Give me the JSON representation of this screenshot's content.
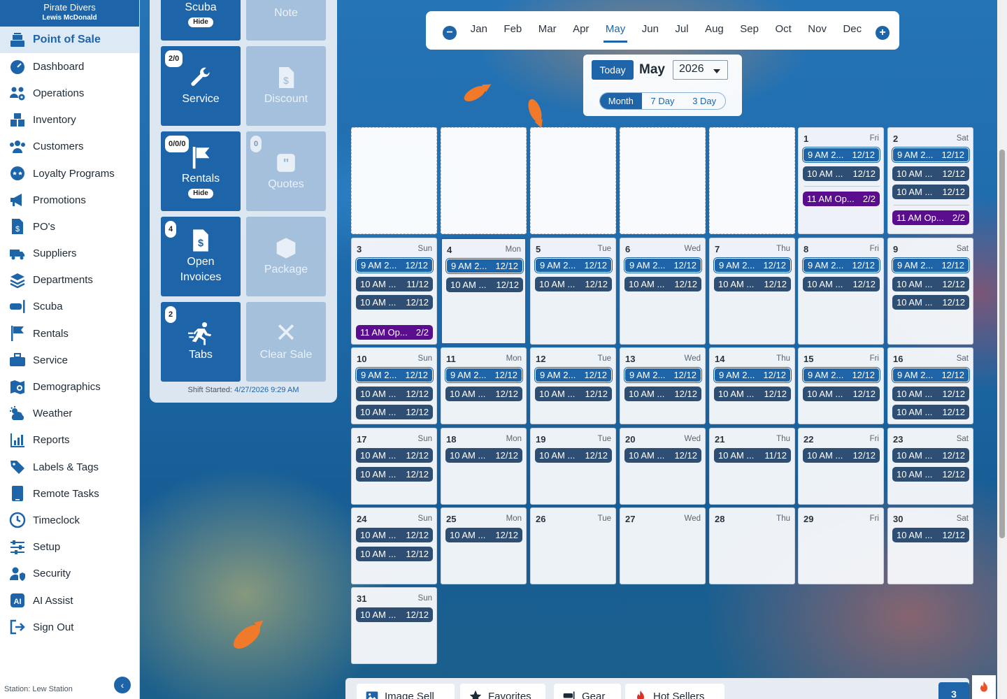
{
  "app": {
    "store_name": "Pirate Divers",
    "user_name": "Lewis McDonald",
    "station": "Station: Lew Station"
  },
  "sidebar": {
    "items": [
      {
        "key": "pos",
        "label": "Point of Sale",
        "icon": "cash-register-icon",
        "active": true
      },
      {
        "key": "dashboard",
        "label": "Dashboard",
        "icon": "gauge-icon"
      },
      {
        "key": "operations",
        "label": "Operations",
        "icon": "people-gear-icon"
      },
      {
        "key": "inventory",
        "label": "Inventory",
        "icon": "boxes-icon"
      },
      {
        "key": "customers",
        "label": "Customers",
        "icon": "users-icon"
      },
      {
        "key": "loyalty",
        "label": "Loyalty Programs",
        "icon": "star-face-icon"
      },
      {
        "key": "promotions",
        "label": "Promotions",
        "icon": "megaphone-icon"
      },
      {
        "key": "pos-orders",
        "label": "PO's",
        "icon": "invoice-icon"
      },
      {
        "key": "suppliers",
        "label": "Suppliers",
        "icon": "truck-icon"
      },
      {
        "key": "departments",
        "label": "Departments",
        "icon": "layers-icon"
      },
      {
        "key": "scuba",
        "label": "Scuba",
        "icon": "mask-icon"
      },
      {
        "key": "rentals",
        "label": "Rentals",
        "icon": "flag-icon"
      },
      {
        "key": "service",
        "label": "Service",
        "icon": "toolbox-icon"
      },
      {
        "key": "demographics",
        "label": "Demographics",
        "icon": "map-pin-icon"
      },
      {
        "key": "weather",
        "label": "Weather",
        "icon": "sun-cloud-icon"
      },
      {
        "key": "reports",
        "label": "Reports",
        "icon": "bar-chart-icon"
      },
      {
        "key": "labels",
        "label": "Labels & Tags",
        "icon": "tag-icon"
      },
      {
        "key": "remote",
        "label": "Remote Tasks",
        "icon": "tablet-icon"
      },
      {
        "key": "timeclock",
        "label": "Timeclock",
        "icon": "clock-icon"
      },
      {
        "key": "setup",
        "label": "Setup",
        "icon": "sliders-icon"
      },
      {
        "key": "security",
        "label": "Security",
        "icon": "user-shield-icon"
      },
      {
        "key": "ai",
        "label": "AI Assist",
        "icon": "ai-icon"
      },
      {
        "key": "signout",
        "label": "Sign Out",
        "icon": "sign-out-icon"
      }
    ]
  },
  "tiles": {
    "scuba": {
      "label": "Scuba",
      "hide": "Hide"
    },
    "note": {
      "label": "Note"
    },
    "service": {
      "label": "Service",
      "badge": "2/0"
    },
    "discount": {
      "label": "Discount"
    },
    "rentals": {
      "label": "Rentals",
      "badge": "0/0/0",
      "hide": "Hide"
    },
    "quotes": {
      "label": "Quotes",
      "badge": "0"
    },
    "open_invoices": {
      "label": "Open Invoices",
      "badge": "4"
    },
    "package": {
      "label": "Package"
    },
    "tabs": {
      "label": "Tabs",
      "badge": "2"
    },
    "clear_sale": {
      "label": "Clear Sale"
    }
  },
  "shift": {
    "label": "Shift Started:",
    "value": "4/27/2026 9:29 AM"
  },
  "calendar": {
    "months": [
      "Jan",
      "Feb",
      "Mar",
      "Apr",
      "May",
      "Jun",
      "Jul",
      "Aug",
      "Sep",
      "Oct",
      "Nov",
      "Dec"
    ],
    "current_month": "May",
    "today_label": "Today",
    "title_month": "May",
    "year": "2026",
    "views": [
      "Month",
      "7 Day",
      "3 Day"
    ],
    "selected_view": "Month",
    "leading_empty": 5,
    "selected_day": 4,
    "days": [
      {
        "d": "1",
        "w": "Fri",
        "ev": [
          [
            "9 AM 2...",
            "12/12",
            "pub"
          ],
          [
            "10 AM ...",
            "12/12",
            "dark"
          ],
          [
            "11 AM Op...",
            "2/2",
            "purple"
          ]
        ]
      },
      {
        "d": "2",
        "w": "Sat",
        "ev": [
          [
            "9 AM 2...",
            "12/12",
            "pub"
          ],
          [
            "10 AM ...",
            "12/12",
            "dark"
          ],
          [
            "10 AM ...",
            "12/12",
            "dark"
          ],
          [
            "11 AM Op...",
            "2/2",
            "purple"
          ]
        ]
      },
      {
        "d": "3",
        "w": "Sun",
        "ev": [
          [
            "9 AM 2...",
            "12/12",
            "pub"
          ],
          [
            "10 AM ...",
            "11/12",
            "dark"
          ],
          [
            "10 AM ...",
            "12/12",
            "dark"
          ],
          [
            "11 AM Op...",
            "2/2",
            "purple"
          ]
        ]
      },
      {
        "d": "4",
        "w": "Mon",
        "ev": [
          [
            "9 AM 2...",
            "12/12",
            "pub"
          ],
          [
            "10 AM ...",
            "12/12",
            "dark"
          ]
        ]
      },
      {
        "d": "5",
        "w": "Tue",
        "ev": [
          [
            "9 AM 2...",
            "12/12",
            "pub"
          ],
          [
            "10 AM ...",
            "12/12",
            "dark"
          ]
        ]
      },
      {
        "d": "6",
        "w": "Wed",
        "ev": [
          [
            "9 AM 2...",
            "12/12",
            "pub"
          ],
          [
            "10 AM ...",
            "12/12",
            "dark"
          ]
        ]
      },
      {
        "d": "7",
        "w": "Thu",
        "ev": [
          [
            "9 AM 2...",
            "12/12",
            "pub"
          ],
          [
            "10 AM ...",
            "12/12",
            "dark"
          ]
        ]
      },
      {
        "d": "8",
        "w": "Fri",
        "ev": [
          [
            "9 AM 2...",
            "12/12",
            "pub"
          ],
          [
            "10 AM ...",
            "12/12",
            "dark"
          ]
        ]
      },
      {
        "d": "9",
        "w": "Sat",
        "ev": [
          [
            "9 AM 2...",
            "12/12",
            "pub"
          ],
          [
            "10 AM ...",
            "12/12",
            "dark"
          ],
          [
            "10 AM ...",
            "12/12",
            "dark"
          ]
        ]
      },
      {
        "d": "10",
        "w": "Sun",
        "ev": [
          [
            "9 AM 2...",
            "12/12",
            "pub"
          ],
          [
            "10 AM ...",
            "12/12",
            "dark"
          ],
          [
            "10 AM ...",
            "12/12",
            "dark"
          ]
        ]
      },
      {
        "d": "11",
        "w": "Mon",
        "ev": [
          [
            "9 AM 2...",
            "12/12",
            "pub"
          ],
          [
            "10 AM ...",
            "12/12",
            "dark"
          ]
        ]
      },
      {
        "d": "12",
        "w": "Tue",
        "ev": [
          [
            "9 AM 2...",
            "12/12",
            "pub"
          ],
          [
            "10 AM ...",
            "12/12",
            "dark"
          ]
        ]
      },
      {
        "d": "13",
        "w": "Wed",
        "ev": [
          [
            "9 AM 2...",
            "12/12",
            "pub"
          ],
          [
            "10 AM ...",
            "12/12",
            "dark"
          ]
        ]
      },
      {
        "d": "14",
        "w": "Thu",
        "ev": [
          [
            "9 AM 2...",
            "12/12",
            "pub"
          ],
          [
            "10 AM ...",
            "12/12",
            "dark"
          ]
        ]
      },
      {
        "d": "15",
        "w": "Fri",
        "ev": [
          [
            "9 AM 2...",
            "12/12",
            "pub"
          ],
          [
            "10 AM ...",
            "12/12",
            "dark"
          ]
        ]
      },
      {
        "d": "16",
        "w": "Sat",
        "ev": [
          [
            "9 AM 2...",
            "12/12",
            "pub"
          ],
          [
            "10 AM ...",
            "12/12",
            "dark"
          ],
          [
            "10 AM ...",
            "12/12",
            "dark"
          ]
        ]
      },
      {
        "d": "17",
        "w": "Sun",
        "ev": [
          [
            "10 AM ...",
            "12/12",
            "dark"
          ],
          [
            "10 AM ...",
            "12/12",
            "dark"
          ]
        ]
      },
      {
        "d": "18",
        "w": "Mon",
        "ev": [
          [
            "10 AM ...",
            "12/12",
            "dark"
          ]
        ]
      },
      {
        "d": "19",
        "w": "Tue",
        "ev": [
          [
            "10 AM ...",
            "12/12",
            "dark"
          ]
        ]
      },
      {
        "d": "20",
        "w": "Wed",
        "ev": [
          [
            "10 AM ...",
            "12/12",
            "dark"
          ]
        ]
      },
      {
        "d": "21",
        "w": "Thu",
        "ev": [
          [
            "10 AM ...",
            "11/12",
            "dark"
          ]
        ]
      },
      {
        "d": "22",
        "w": "Fri",
        "ev": [
          [
            "10 AM ...",
            "12/12",
            "dark"
          ]
        ]
      },
      {
        "d": "23",
        "w": "Sat",
        "ev": [
          [
            "10 AM ...",
            "12/12",
            "dark"
          ],
          [
            "10 AM ...",
            "12/12",
            "dark"
          ]
        ]
      },
      {
        "d": "24",
        "w": "Sun",
        "ev": [
          [
            "10 AM ...",
            "12/12",
            "dark"
          ],
          [
            "10 AM ...",
            "12/12",
            "dark"
          ]
        ]
      },
      {
        "d": "25",
        "w": "Mon",
        "ev": [
          [
            "10 AM ...",
            "12/12",
            "dark"
          ]
        ]
      },
      {
        "d": "26",
        "w": "Tue",
        "ev": []
      },
      {
        "d": "27",
        "w": "Wed",
        "ev": []
      },
      {
        "d": "28",
        "w": "Thu",
        "ev": []
      },
      {
        "d": "29",
        "w": "Fri",
        "ev": []
      },
      {
        "d": "30",
        "w": "Sat",
        "ev": [
          [
            "10 AM ...",
            "12/12",
            "dark"
          ]
        ]
      },
      {
        "d": "31",
        "w": "Sun",
        "ev": [
          [
            "10 AM ...",
            "12/12",
            "dark"
          ]
        ]
      }
    ]
  },
  "bottom_tabs": {
    "image_sell": "Image Sell",
    "favorites": "Favorites",
    "gear": "Gear",
    "hot_sellers": "Hot Sellers",
    "count": "3"
  },
  "colors": {
    "primary": "#1e64a8",
    "event_dark": "#2f4e73",
    "event_purple": "#5a0d8c"
  }
}
